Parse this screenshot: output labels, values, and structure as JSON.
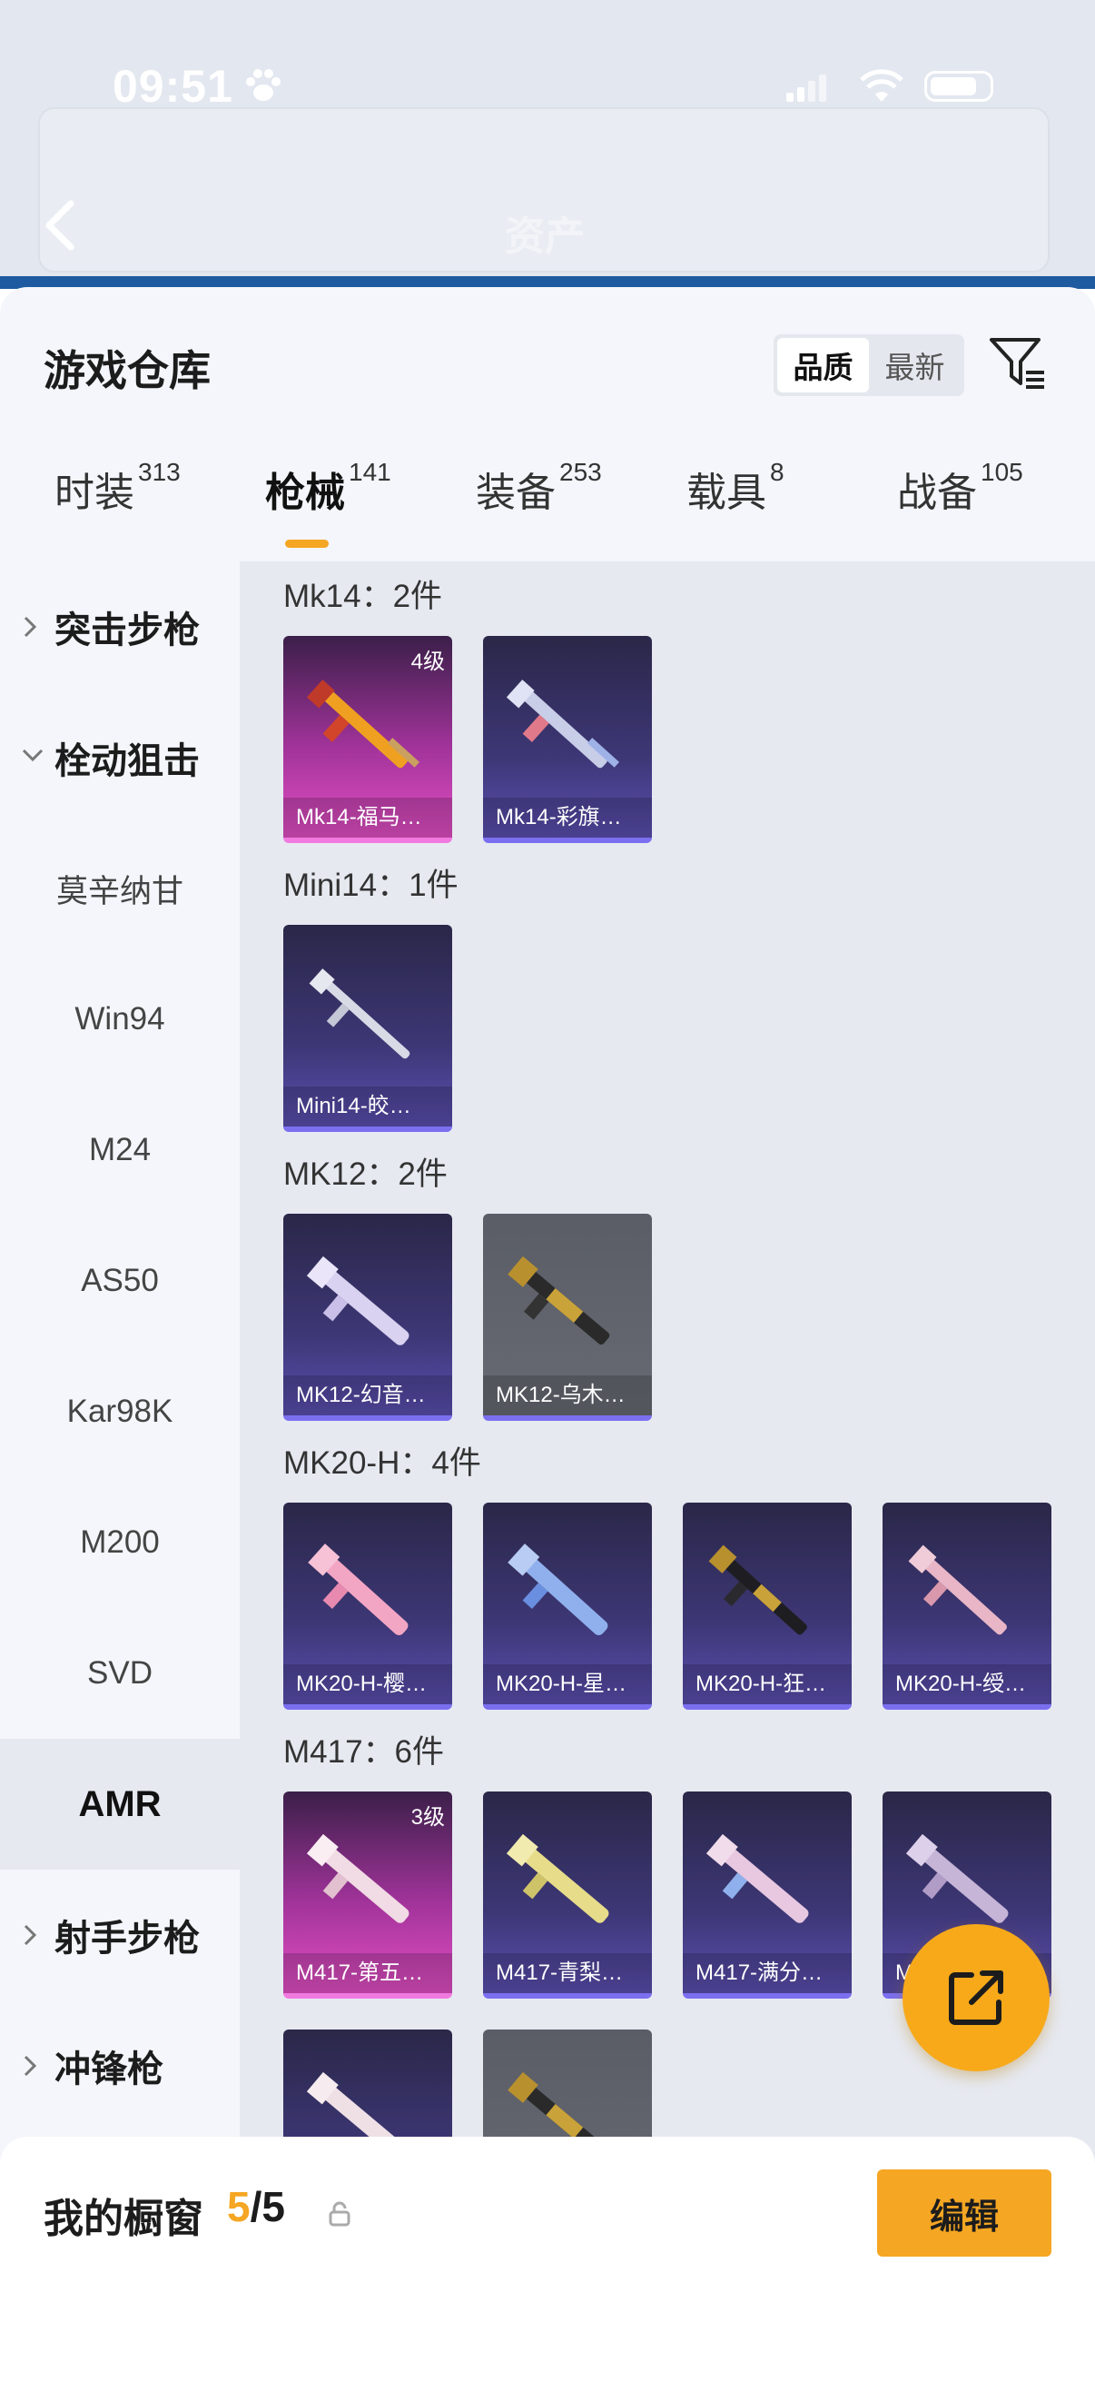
{
  "status_bar": {
    "time": "09:51"
  },
  "header": {
    "title": "资产"
  },
  "sheet": {
    "title": "游戏仓库",
    "sort": {
      "options": [
        "品质",
        "最新"
      ],
      "active": "品质"
    }
  },
  "tabs": [
    {
      "label": "时装",
      "count": "313"
    },
    {
      "label": "枪械",
      "count": "141",
      "active": true
    },
    {
      "label": "装备",
      "count": "253"
    },
    {
      "label": "载具",
      "count": "8"
    },
    {
      "label": "战备",
      "count": "105"
    }
  ],
  "sidebar": {
    "groups": [
      {
        "label": "突击步枪",
        "expanded": false
      },
      {
        "label": "栓动狙击",
        "expanded": true
      },
      {
        "label": "射手步枪",
        "expanded": false
      },
      {
        "label": "冲锋枪",
        "expanded": false
      }
    ],
    "items": [
      "莫辛纳甘",
      "Win94",
      "M24",
      "AS50",
      "Kar98K",
      "M200",
      "SVD",
      "AMR"
    ],
    "active_item": "AMR"
  },
  "sections": [
    {
      "title": "Mk14：2件",
      "cards": [
        {
          "label": "Mk14-福马…",
          "level": "4级",
          "style": "pink"
        },
        {
          "label": "Mk14-彩旗…",
          "style": "purple"
        }
      ]
    },
    {
      "title": "Mini14：1件",
      "cards": [
        {
          "label": "Mini14-皎…",
          "style": "purple"
        }
      ]
    },
    {
      "title": "MK12：2件",
      "cards": [
        {
          "label": "MK12-幻音…",
          "style": "purple"
        },
        {
          "label": "MK12-乌木…",
          "style": "gray"
        }
      ]
    },
    {
      "title": "MK20-H：4件",
      "cards": [
        {
          "label": "MK20-H-樱…",
          "style": "purple"
        },
        {
          "label": "MK20-H-星…",
          "style": "purple"
        },
        {
          "label": "MK20-H-狂…",
          "style": "purple"
        },
        {
          "label": "MK20-H-绶…",
          "style": "purple"
        }
      ]
    },
    {
      "title": "M417：6件",
      "cards": [
        {
          "label": "M417-第五…",
          "level": "3级",
          "style": "pink"
        },
        {
          "label": "M417-青梨…",
          "style": "purple"
        },
        {
          "label": "M417-满分…",
          "style": "purple"
        },
        {
          "label": "M…",
          "style": "purple"
        },
        {
          "label": "",
          "style": "purple"
        },
        {
          "label": "",
          "style": "gray"
        }
      ]
    }
  ],
  "showcase": {
    "title": "我的橱窗",
    "current": "5",
    "total": "/5",
    "edit_label": "编辑"
  },
  "colors": {
    "accent": "#f5a623",
    "card_purple": "#3d3776",
    "card_pink": "#a1339a"
  }
}
